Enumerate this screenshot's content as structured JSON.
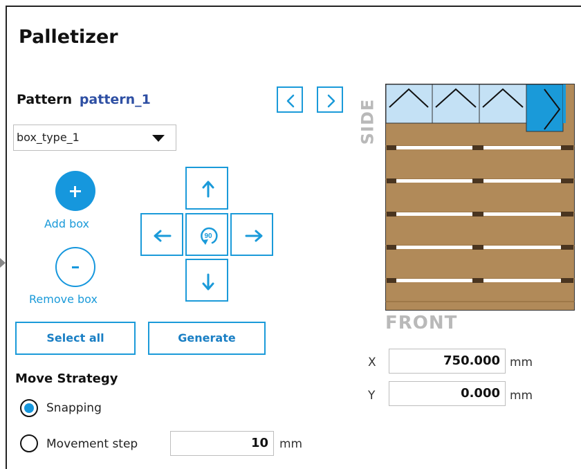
{
  "title": "Palletizer",
  "pattern": {
    "label": "Pattern",
    "name": "pattern_1"
  },
  "box_type": {
    "selected": "box_type_1"
  },
  "add_box_label": "Add box",
  "remove_box_label": "Remove box",
  "select_all_label": "Select all",
  "generate_label": "Generate",
  "move_strategy": {
    "heading": "Move Strategy",
    "options": [
      {
        "label": "Snapping",
        "selected": true
      },
      {
        "label": "Movement step",
        "selected": false
      }
    ],
    "step_value": "10",
    "step_unit": "mm"
  },
  "rotate_button_text": "90",
  "pallet_view": {
    "side_label": "SIDE",
    "front_label": "FRONT",
    "boxes": [
      {
        "selected": false,
        "icon": "chevron-up-icon"
      },
      {
        "selected": false,
        "icon": "chevron-up-icon"
      },
      {
        "selected": false,
        "icon": "chevron-up-icon"
      },
      {
        "selected": true,
        "icon": "chevron-right-icon"
      }
    ]
  },
  "position": {
    "x_label": "X",
    "x_value": "750.000",
    "y_label": "Y",
    "y_value": "0.000",
    "unit": "mm"
  },
  "colors": {
    "accent": "#1697dd",
    "pattern_name": "#2e4fa3",
    "pallet_wood": "#b18a59",
    "box_fill": "#c4e1f5",
    "box_selected_fill": "#1a9ad9"
  }
}
